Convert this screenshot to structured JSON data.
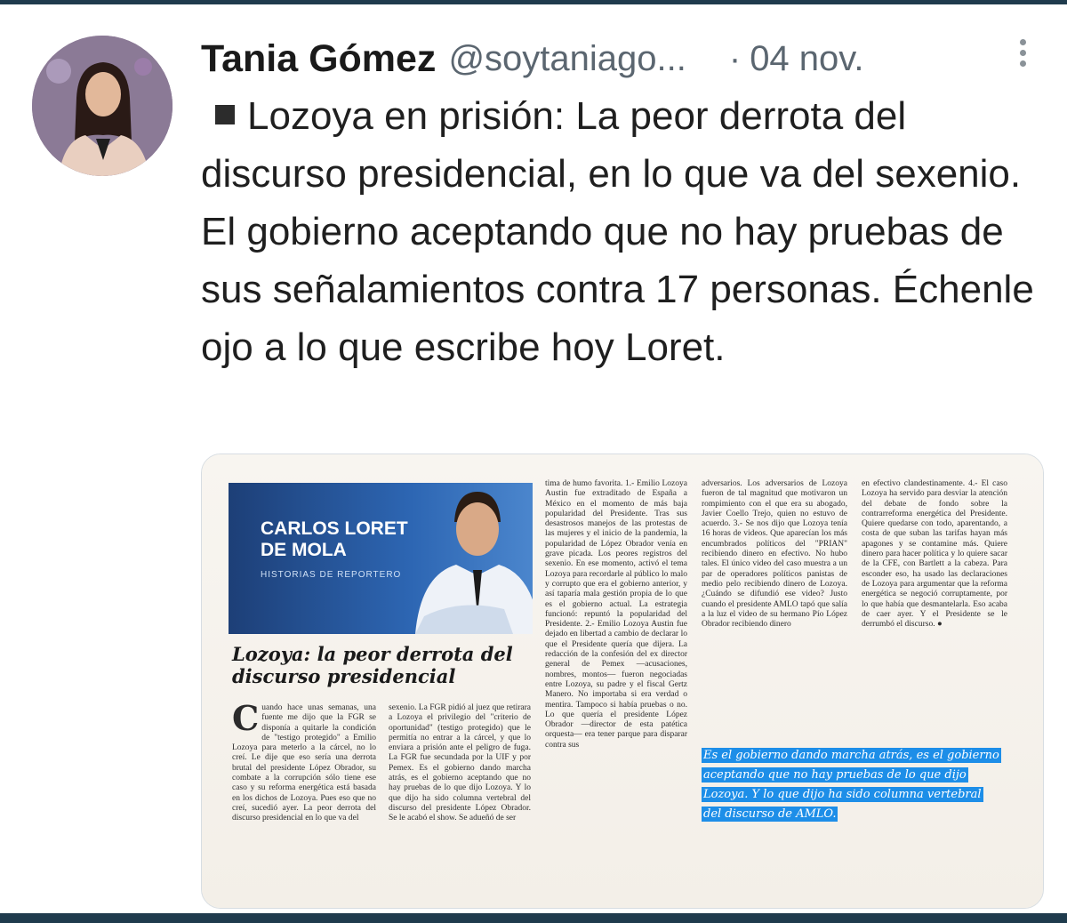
{
  "tweet": {
    "author_name": "Tania Gómez",
    "handle": "@soytaniago...",
    "separator": "·",
    "date": "04 nov.",
    "text": "Lozoya en prisión: La peor derrota del discurso presidencial, en lo que va del sexenio. El gobierno aceptando que no hay pruebas de sus señalamientos contra 17 personas. Échenle ojo a lo que escribe hoy Loret."
  },
  "clipping": {
    "columnist": "CARLOS LORET DE MOLA",
    "section": "HISTORIAS DE REPORTERO",
    "headline": "Lozoya: la peor derrota del discurso presidencial",
    "highlight": "Es el gobierno dando marcha atrás, es el gobierno aceptando que no hay pruebas de lo que dijo Lozoya. Y lo que dijo ha sido columna vertebral del discurso de AMLO."
  },
  "colors": {
    "accent_bar": "#1f3b4d",
    "highlight": "#1d8ee8",
    "banner": "#1d3f77"
  }
}
